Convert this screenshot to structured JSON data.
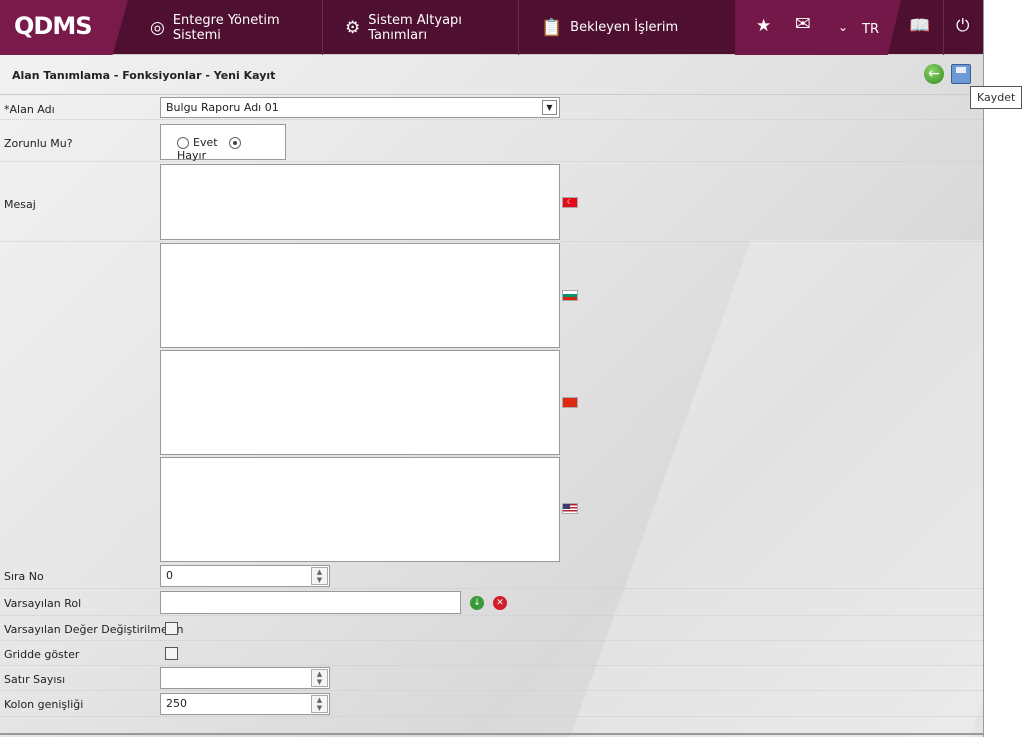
{
  "header": {
    "logo": "QDMS",
    "nav": [
      {
        "label": "Entegre Yönetim Sistemi",
        "icon": "qdms-icon"
      },
      {
        "label": "Sistem Altyapı Tanımları",
        "icon": "gear-icon"
      },
      {
        "label": "Bekleyen İşlerim",
        "icon": "clipboard-icon"
      }
    ],
    "language": "TR"
  },
  "page": {
    "title": "Alan Tanımlama - Fonksiyonlar - Yeni Kayıt",
    "save_tooltip": "Kaydet"
  },
  "form": {
    "alan_adi": {
      "label": "*Alan Adı",
      "value": "Bulgu Raporu Adı  01"
    },
    "zorunlu": {
      "label": "Zorunlu Mu?",
      "options": [
        "Evet",
        "Hayır"
      ],
      "selected": "Hayır"
    },
    "mesaj": {
      "label": "Mesaj",
      "languages": [
        "tr",
        "bg",
        "cn",
        "us"
      ]
    },
    "sira_no": {
      "label": "Sıra No",
      "value": "0"
    },
    "varsayilan_rol": {
      "label": "Varsayılan Rol",
      "value": ""
    },
    "degistirilmesin": {
      "label": "Varsayılan Değer Değiştirilmesin",
      "checked": false
    },
    "gridde": {
      "label": "Gridde göster",
      "checked": false
    },
    "satir_sayisi": {
      "label": "Satır Sayısı",
      "value": ""
    },
    "kolon_genisligi": {
      "label": "Kolon genişliği",
      "value": "250"
    }
  }
}
